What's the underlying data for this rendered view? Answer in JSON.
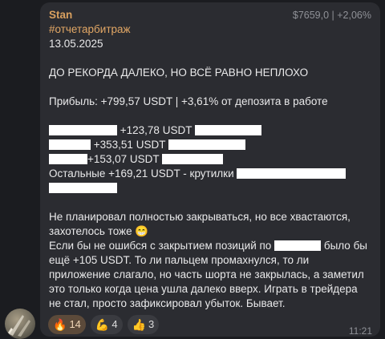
{
  "message": {
    "author": "Stan",
    "price_badge": "$7659,0 | +2,06%",
    "hashtag": "#отчетарбитраж",
    "date": "13.05.2025",
    "headline": "ДО РЕКОРДА ДАЛЕКО, НО ВСЁ РАВНО НЕПЛОХО",
    "profit_line": "Прибыль: +799,57 USDT | +3,61% от депозита в работе",
    "items": [
      {
        "value": "+123,78 USDT"
      },
      {
        "value": "+353,51 USDT"
      },
      {
        "value": "+153,07 USDT"
      }
    ],
    "others_line": "Остальные +169,21 USDT - крутилки",
    "para1": "Не планировал полностью закрываться, но все хвастаются, захотелось тоже 😁",
    "para2_prefix": "Если бы не ошибся с закрытием позиций по",
    "para2_suffix": "было бы ещё +105 USDT. То ли пальцем промахнулся, то ли приложение слагало, но часть шорта не закрылась, а заметил это только когда цена ушла далеко вверх. Играть в трейдера не стал, просто зафиксировал убыток. Бывает.",
    "time": "11:21"
  },
  "reactions": [
    {
      "emoji": "🔥",
      "count": "14",
      "active": true
    },
    {
      "emoji": "💪",
      "count": "4",
      "active": false
    },
    {
      "emoji": "👍",
      "count": "3",
      "active": false
    }
  ],
  "colors": {
    "background": "#1b1c20",
    "bubble": "#2b2c31",
    "author": "#d9a05f",
    "hashtag": "#e2a765",
    "text": "#e9e9ea",
    "muted": "#8f9197",
    "redaction": "#ffffff"
  },
  "icons": {
    "avatar": "avatar-image"
  }
}
